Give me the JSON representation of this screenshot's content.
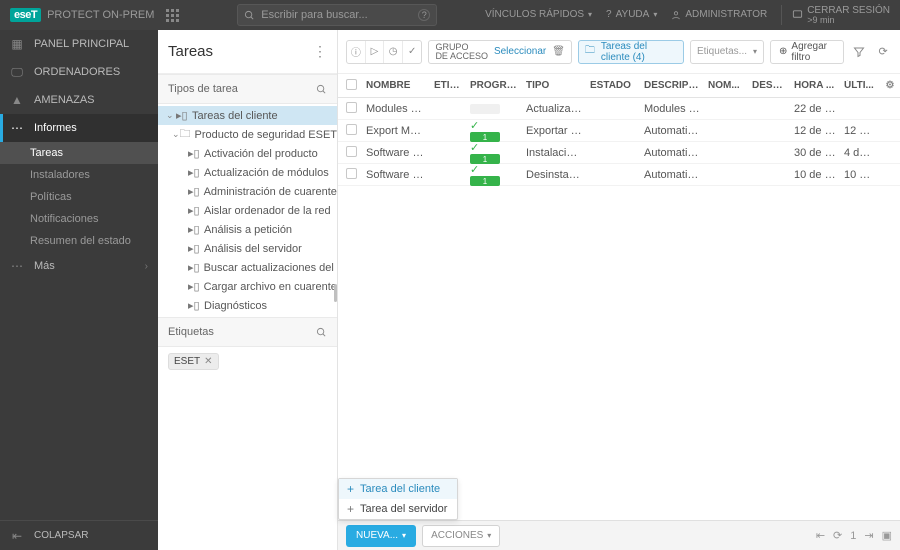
{
  "header": {
    "logo": "eseT",
    "product": "PROTECT ON-PREM",
    "search_placeholder": "Escribir para buscar...",
    "quick_links": "VÍNCULOS RÁPIDOS",
    "help": "AYUDA",
    "user": "ADMINISTRATOR",
    "logout_title": "CERRAR SESIÓN",
    "logout_sub": ">9 min"
  },
  "sidebar": {
    "items": [
      "PANEL PRINCIPAL",
      "ORDENADORES",
      "AMENAZAS",
      "Informes",
      "Tareas",
      "Instaladores",
      "Políticas",
      "Notificaciones",
      "Resumen del estado",
      "Más"
    ],
    "collapse": "COLAPSAR"
  },
  "mid": {
    "title": "Tareas",
    "types_header": "Tipos de tarea",
    "tags_header": "Etiquetas",
    "tree": [
      "Tareas del cliente",
      "Producto de seguridad ESET",
      "Activación del producto",
      "Actualización de módulos",
      "Administración de cuarentena",
      "Aislar ordenador de la red",
      "Análisis a petición",
      "Análisis del servidor",
      "Buscar actualizaciones del producto",
      "Cargar archivo en cuarentena",
      "Diagnósticos"
    ],
    "tag_chip": "ESET"
  },
  "toolbar": {
    "group_label": "GRUPO\nDE ACCESO",
    "select": "Seleccionar",
    "chip_tasks": "Tareas del cliente (4)",
    "chip_tags": "Etiquetas...",
    "add_filter": "Agregar filtro"
  },
  "table": {
    "headers": [
      "NOMBRE",
      "ETIQ...",
      "PROGRESO",
      "TIPO",
      "ESTADO",
      "DESCRIPCIÓN",
      "NOM...",
      "DESC...",
      "HORA ...",
      "ÚLTI..."
    ],
    "rows": [
      {
        "name": "Modules U...",
        "check": false,
        "prog": "",
        "type": "Actualizació...",
        "state": "",
        "desc": "Modules of t...",
        "np": "",
        "dp": "",
        "time": "22 de a...",
        "last": ""
      },
      {
        "name": "Export Man...",
        "check": true,
        "prog": "1",
        "type": "Exportar con...",
        "state": "",
        "desc": "Automaticall...",
        "np": "",
        "dp": "",
        "time": "12 de j...",
        "last": "12 de ..."
      },
      {
        "name": "Software In...",
        "check": true,
        "prog": "1",
        "type": "Instalación d...",
        "state": "",
        "desc": "Automaticall...",
        "np": "",
        "dp": "",
        "time": "30 de a...",
        "last": "4 de ..."
      },
      {
        "name": "Software U...",
        "check": true,
        "prog": "1",
        "type": "Desinstalació...",
        "state": "",
        "desc": "Automaticall...",
        "np": "",
        "dp": "",
        "time": "10 de m...",
        "last": "10 de ..."
      }
    ]
  },
  "popup": {
    "client": "Tarea del cliente",
    "server": "Tarea del servidor"
  },
  "footer": {
    "new": "NUEVA...",
    "actions": "ACCIONES"
  }
}
